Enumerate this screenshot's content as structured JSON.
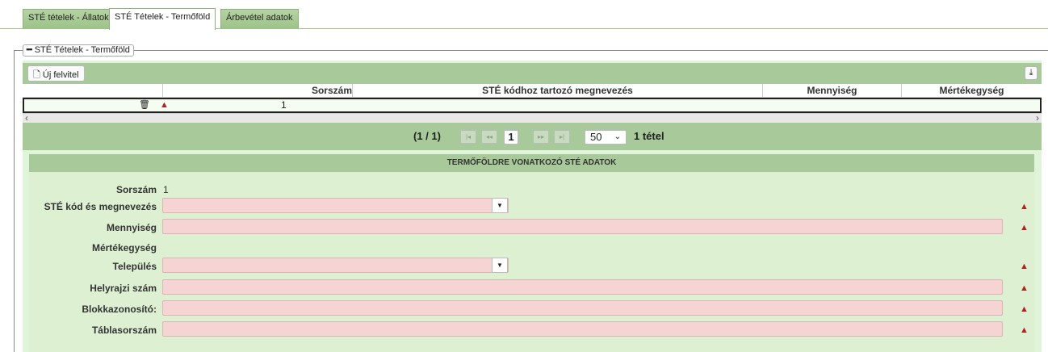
{
  "tabs": [
    {
      "label": "STÉ tételek - Állatok"
    },
    {
      "label": "STÉ Tételek - Termőföld"
    },
    {
      "label": "Árbevétel adatok"
    }
  ],
  "fieldset": {
    "legend": "STÉ Tételek - Termőföld",
    "collapse_symbol": "━"
  },
  "toolbar": {
    "new_label": "Új felvitel",
    "export_icon": "export-icon"
  },
  "table": {
    "columns": [
      "Sorszám",
      "STÉ kódhoz tartozó megnevezés",
      "Mennyiség",
      "Mértékegység"
    ],
    "rows": [
      {
        "sorszam": "1"
      }
    ]
  },
  "pager": {
    "summary": "(1 / 1)",
    "current_page": "1",
    "page_size": "50",
    "total": "1 tétel"
  },
  "form": {
    "title": "TERMŐFÖLDRE VONATKOZÓ STÉ ADATOK",
    "sorszam_label": "Sorszám",
    "sorszam_value": "1",
    "ste_kod_label": "STÉ kód és megnevezés",
    "mennyiseg_label": "Mennyiség",
    "mertekegyseg_label": "Mértékegység",
    "telepules_label": "Település",
    "helyrajzi_label": "Helyrajzi szám",
    "blokk_label": "Blokkazonosító:",
    "tabla_label": "Táblasorszám"
  },
  "colors": {
    "header_green": "#a8c99a",
    "panel_green": "#dff4d8",
    "required_pink": "#f6d4d3",
    "warning_red": "#b22222"
  }
}
